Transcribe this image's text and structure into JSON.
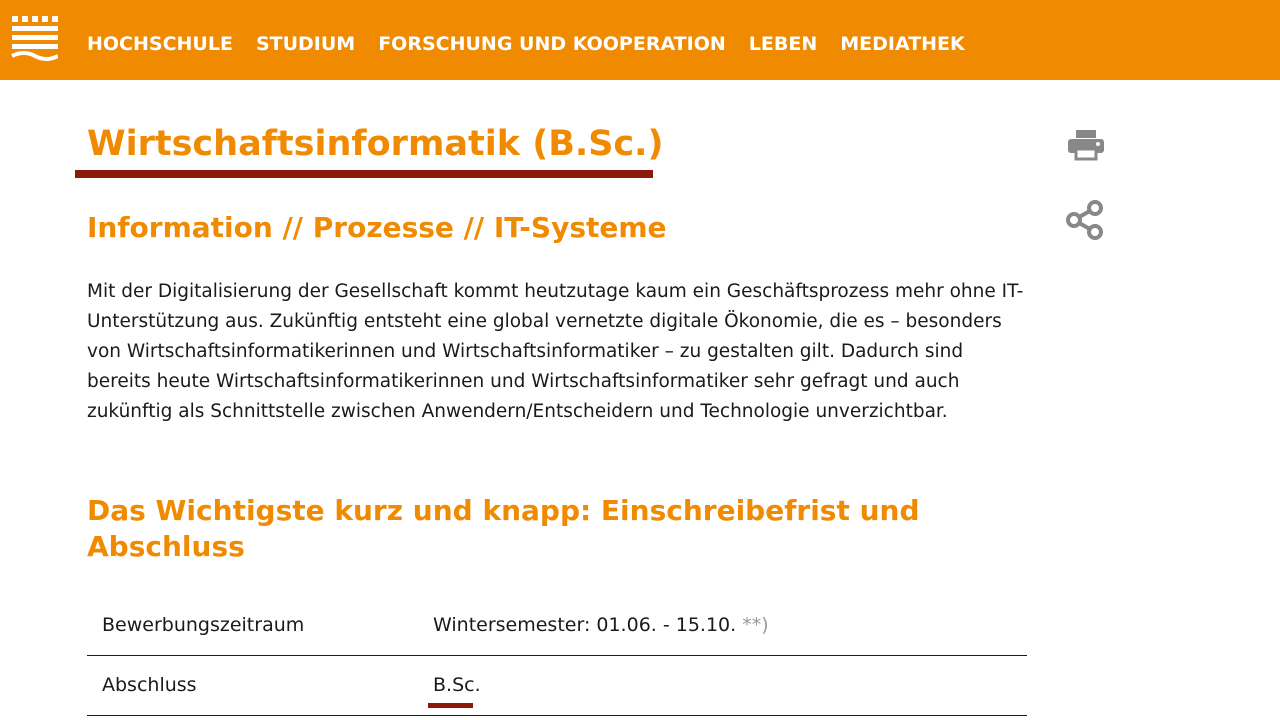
{
  "header": {
    "nav": [
      {
        "label": "HOCHSCHULE"
      },
      {
        "label": "STUDIUM"
      },
      {
        "label": "FORSCHUNG UND KOOPERATION"
      },
      {
        "label": "LEBEN"
      },
      {
        "label": "MEDIATHEK"
      }
    ],
    "logo_icon": "university-logo-icon",
    "accent_color": "#f08a00"
  },
  "page": {
    "title": "Wirtschaftsinformatik (B.Sc.)",
    "subtitle": "Information // Prozesse // IT-Systeme",
    "intro": "Mit der Digitalisierung der Gesellschaft kommt heutzutage kaum ein Geschäftsprozess mehr ohne IT-Unterstützung aus. Zukünftig entsteht eine global vernetzte digitale Ökonomie, die es – besonders von Wirtschaftsinformatikerinnen und Wirtschaftsinformatiker – zu gestalten gilt. Dadurch sind bereits heute Wirtschaftsinformatikerinnen und Wirtschaftsinformatiker sehr gefragt und auch zukünftig als Schnittstelle zwischen Anwendern/Entscheidern und Technologie unverzichtbar.",
    "section_heading": "Das Wichtigste kurz und knapp: Einschreibefrist und Abschluss",
    "underline_color": "#8b1a0c"
  },
  "facts": {
    "rows": [
      {
        "label": "Bewerbungszeitraum",
        "value": "Wintersemester: 01.06. - 15.10.",
        "note": "**)"
      },
      {
        "label": "Abschluss",
        "value": "B.Sc."
      }
    ]
  },
  "tools": {
    "print_icon": "print-icon",
    "share_icon": "share-icon",
    "icon_color": "#888888"
  }
}
